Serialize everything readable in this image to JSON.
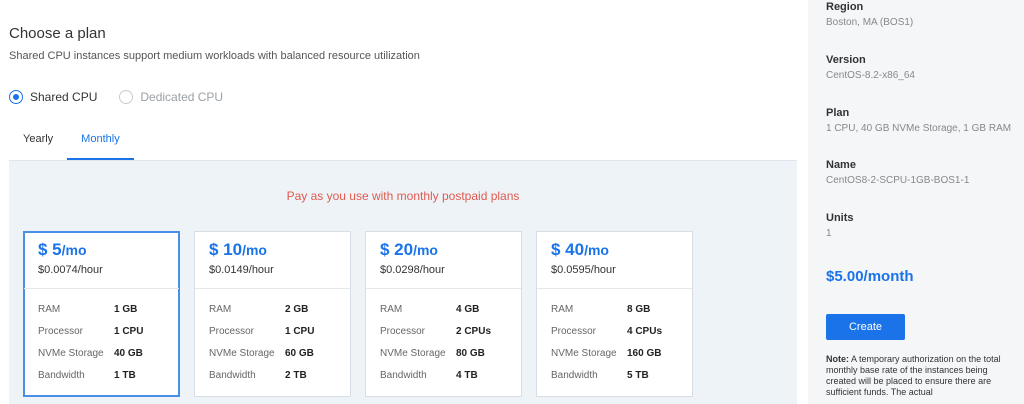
{
  "plan": {
    "title": "Choose a plan",
    "subtitle": "Shared CPU instances support medium workloads with balanced resource utilization",
    "cpu_options": [
      {
        "label": "Shared CPU",
        "checked": true
      },
      {
        "label": "Dedicated CPU",
        "checked": false
      }
    ],
    "tabs": [
      {
        "label": "Yearly",
        "active": false
      },
      {
        "label": "Monthly",
        "active": true
      }
    ],
    "notice": "Pay as you use with monthly postpaid plans",
    "spec_labels": [
      "RAM",
      "Processor",
      "NVMe Storage",
      "Bandwidth"
    ],
    "cards": [
      {
        "price": "$ 5",
        "unit": "/mo",
        "hourly": "$0.0074/hour",
        "ram": "1 GB",
        "processor": "1 CPU",
        "storage": "40 GB",
        "bandwidth": "1 TB",
        "selected": true
      },
      {
        "price": "$ 10",
        "unit": "/mo",
        "hourly": "$0.0149/hour",
        "ram": "2 GB",
        "processor": "1 CPU",
        "storage": "60 GB",
        "bandwidth": "2 TB",
        "selected": false
      },
      {
        "price": "$ 20",
        "unit": "/mo",
        "hourly": "$0.0298/hour",
        "ram": "4 GB",
        "processor": "2 CPUs",
        "storage": "80 GB",
        "bandwidth": "4 TB",
        "selected": false
      },
      {
        "price": "$ 40",
        "unit": "/mo",
        "hourly": "$0.0595/hour",
        "ram": "8 GB",
        "processor": "4 CPUs",
        "storage": "160 GB",
        "bandwidth": "5 TB",
        "selected": false
      }
    ]
  },
  "summary": {
    "region_label": "Region",
    "region_value": "Boston, MA (BOS1)",
    "version_label": "Version",
    "version_value": "CentOS-8.2-x86_64",
    "plan_label": "Plan",
    "plan_value": "1 CPU, 40 GB NVMe Storage, 1 GB RAM",
    "name_label": "Name",
    "name_value": "CentOS8-2-SCPU-1GB-BOS1-1",
    "units_label": "Units",
    "units_value": "1",
    "total": "$5.00/month",
    "create_label": "Create",
    "note_label": "Note:",
    "note_text": "A temporary authorization on the total monthly base rate of the instances being created will be placed to ensure there are sufficient funds. The actual"
  },
  "colors": {
    "accent": "#1a73e8",
    "notice": "#e05a4e",
    "panel_bg": "#eef3f8",
    "sidebar_bg": "#f4f6f8"
  }
}
